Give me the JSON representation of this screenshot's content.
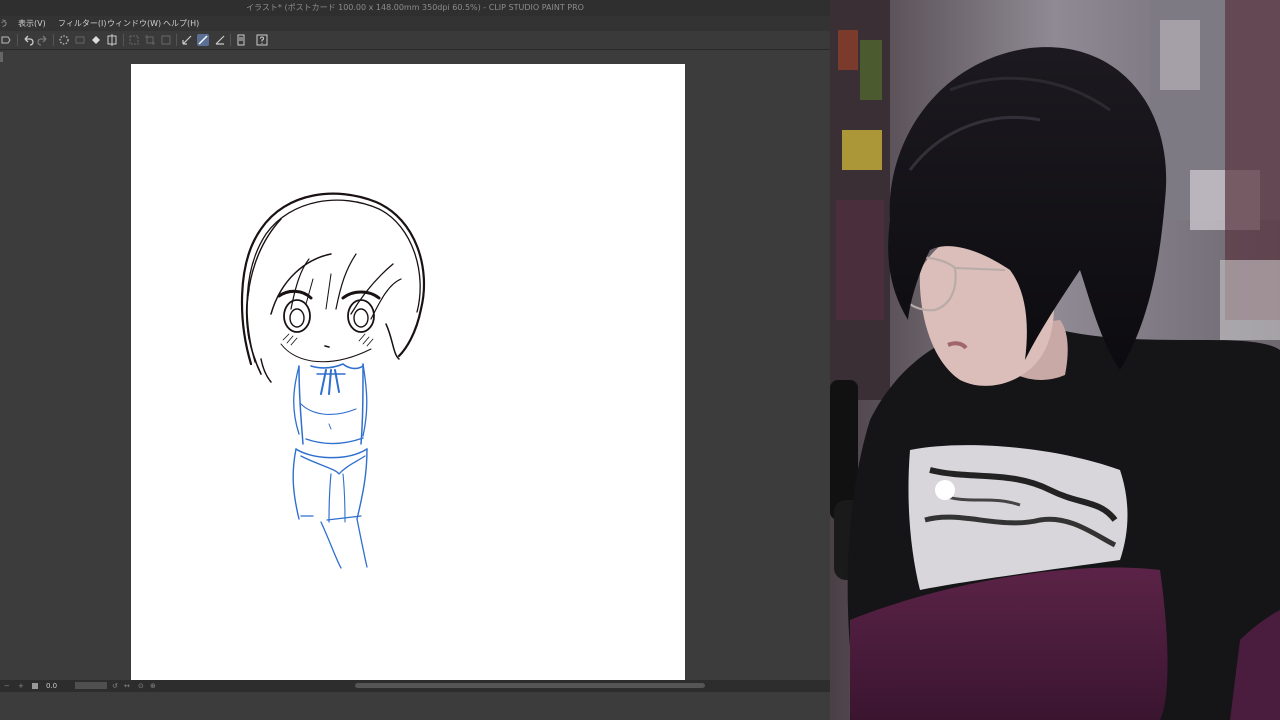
{
  "window": {
    "title": "イラスト* (ポストカード 100.00 x 148.00mm 350dpi 60.5%)  - CLIP STUDIO PAINT PRO"
  },
  "menu": {
    "items": [
      {
        "label": "表示(V)"
      },
      {
        "label": "フィルター(I)"
      },
      {
        "label": "ウィンドウ(W)"
      },
      {
        "label": "ヘルプ(H)"
      }
    ]
  },
  "toolbar": {
    "icons": [
      "undo-icon",
      "redo-icon",
      "loading-icon",
      "fill-icon",
      "transform-icon",
      "clear-icon",
      "selection-icon",
      "crop-icon",
      "pen-icon",
      "pen-active-icon",
      "ruler-icon",
      "layer-icon",
      "help-icon"
    ]
  },
  "status": {
    "zoom": "0.0"
  },
  "colors": {
    "sketch_black": "#1a1212",
    "sketch_blue": "#2f6fcf",
    "canvas": "#ffffff",
    "workspace": "#3c3c3c"
  }
}
